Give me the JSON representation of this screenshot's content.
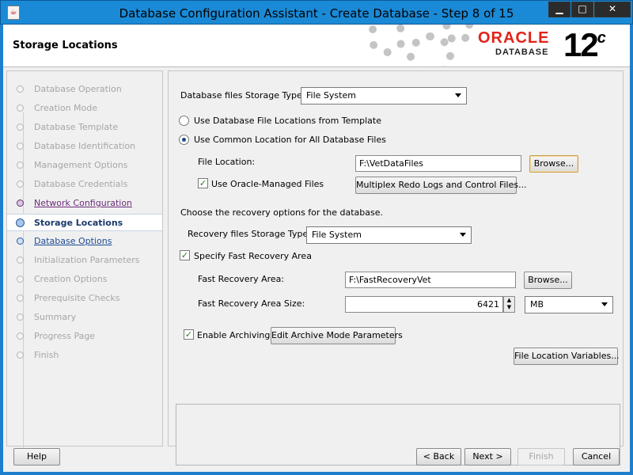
{
  "window": {
    "title": "Database Configuration Assistant - Create Database - Step 8 of 15",
    "min_glyph": "▁",
    "max_glyph": "□",
    "close_glyph": "✕"
  },
  "header": {
    "title": "Storage Locations",
    "brand": "ORACLE",
    "brand_sub": "DATABASE",
    "version": "12",
    "version_suffix": "c",
    "brand_color": "#e2231a"
  },
  "steps": [
    {
      "label": "Database Operation",
      "state": "done"
    },
    {
      "label": "Creation Mode",
      "state": "done"
    },
    {
      "label": "Database Template",
      "state": "done"
    },
    {
      "label": "Database Identification",
      "state": "done"
    },
    {
      "label": "Management Options",
      "state": "done"
    },
    {
      "label": "Database Credentials",
      "state": "done"
    },
    {
      "label": "Network Configuration",
      "state": "visited"
    },
    {
      "label": "Storage Locations",
      "state": "current"
    },
    {
      "label": "Database Options",
      "state": "next"
    },
    {
      "label": "Initialization Parameters",
      "state": "pending"
    },
    {
      "label": "Creation Options",
      "state": "pending"
    },
    {
      "label": "Prerequisite Checks",
      "state": "pending"
    },
    {
      "label": "Summary",
      "state": "pending"
    },
    {
      "label": "Progress Page",
      "state": "pending"
    },
    {
      "label": "Finish",
      "state": "pending"
    }
  ],
  "storage": {
    "type_label": "Database files Storage Type:",
    "type_value": "File System",
    "radio_template": "Use Database File Locations from Template",
    "radio_common": "Use Common Location for All Database Files",
    "file_location_label": "File Location:",
    "file_location_value": "F:\\VetDataFiles",
    "browse": "Browse...",
    "omf_label": "Use Oracle-Managed Files",
    "multiplex": "Multiplex Redo Logs and Control Files..."
  },
  "recovery": {
    "intro": "Choose the recovery options for the database.",
    "type_label": "Recovery files Storage Type:",
    "type_value": "File System",
    "fra_check": "Specify Fast Recovery Area",
    "fra_label": "Fast Recovery Area:",
    "fra_value": "F:\\FastRecoveryVet",
    "browse": "Browse...",
    "size_label": "Fast Recovery Area Size:",
    "size_value": "6421",
    "size_unit": "MB",
    "archiving": "Enable Archiving",
    "edit_archive": "Edit Archive Mode Parameters",
    "variables": "File Location Variables..."
  },
  "footer": {
    "help": "Help",
    "back": "< Back",
    "next": "Next >",
    "finish": "Finish",
    "cancel": "Cancel"
  }
}
